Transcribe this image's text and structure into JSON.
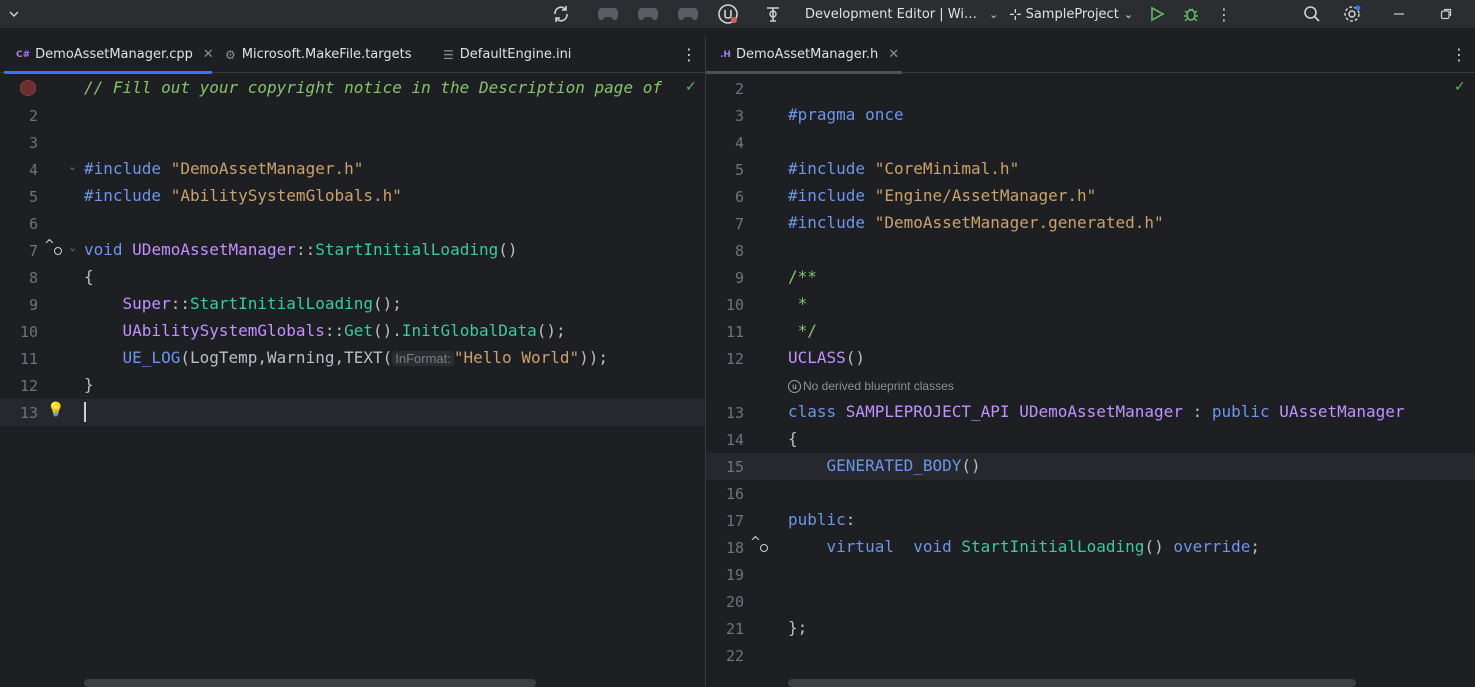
{
  "titlebar": {
    "run_config": "Development Editor | Wi…",
    "project": "SampleProject"
  },
  "left_tabs": [
    {
      "icon": "C#",
      "label": "DemoAssetManager.cpp"
    },
    {
      "label": "Microsoft.MakeFile.targets"
    },
    {
      "label": "DefaultEngine.ini"
    }
  ],
  "right_tabs": [
    {
      "icon": ".H",
      "label": "DemoAssetManager.h"
    }
  ],
  "left_editor": {
    "line_numbers": [
      "",
      "2",
      "3",
      "4",
      "5",
      "6",
      "7",
      "8",
      "9",
      "10",
      "11",
      "12",
      "13"
    ],
    "lines": [
      "// Fill out your copyright notice in the Description page of",
      "",
      "",
      "#include \"DemoAssetManager.h\"",
      "#include \"AbilitySystemGlobals.h\"",
      "",
      "void UDemoAssetManager::StartInitialLoading()",
      "{",
      "    Super::StartInitialLoading();",
      "    UAbilitySystemGlobals::Get().InitGlobalData();",
      "    UE_LOG(LogTemp,Warning,TEXT(InFormat:\"Hello World\"));",
      "}",
      ""
    ],
    "inlay_hint": "InFormat:"
  },
  "right_editor": {
    "line_numbers": [
      "2",
      "3",
      "4",
      "5",
      "6",
      "7",
      "8",
      "9",
      "10",
      "11",
      "12",
      "13",
      "14",
      "15",
      "16",
      "17",
      "18",
      "19",
      "20",
      "21",
      "22"
    ],
    "lines": [
      "",
      "#pragma once",
      "",
      "#include \"CoreMinimal.h\"",
      "#include \"Engine/AssetManager.h\"",
      "#include \"DemoAssetManager.generated.h\"",
      "",
      "/**",
      " *",
      " */",
      "UCLASS()",
      "class SAMPLEPROJECT_API UDemoAssetManager : public UAssetManager",
      "{",
      "    GENERATED_BODY()",
      "",
      "public:",
      "    virtual  void StartInitialLoading() override;",
      "",
      "",
      "};",
      ""
    ],
    "codelens": "No derived blueprint classes"
  }
}
